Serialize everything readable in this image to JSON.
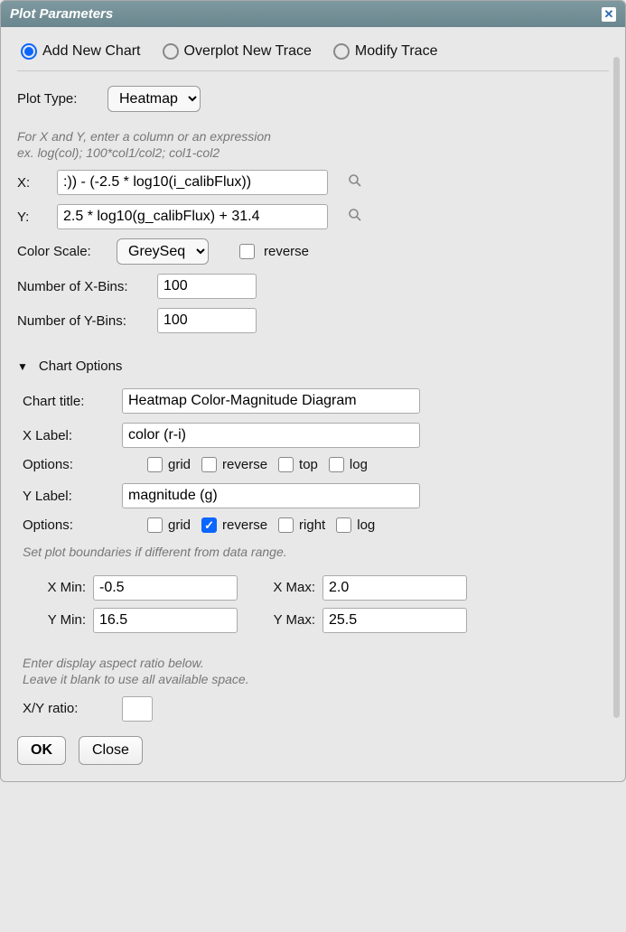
{
  "title": "Plot Parameters",
  "modes": {
    "add": "Add New Chart",
    "overplot": "Overplot New Trace",
    "modify": "Modify Trace",
    "selected": "add"
  },
  "plotType": {
    "label": "Plot Type:",
    "value": "Heatmap"
  },
  "xyHint1": "For X and Y, enter a column or an expression",
  "xyHint2": "ex. log(col); 100*col1/col2; col1-col2",
  "x": {
    "label": "X:",
    "value": ":)) - (-2.5 * log10(i_calibFlux))"
  },
  "y": {
    "label": "Y:",
    "value": "2.5 * log10(g_calibFlux) + 31.4"
  },
  "colorScale": {
    "label": "Color Scale:",
    "value": "GreySeq",
    "reverseLabel": "reverse"
  },
  "xBins": {
    "label": "Number of X-Bins:",
    "value": "100"
  },
  "yBins": {
    "label": "Number of Y-Bins:",
    "value": "100"
  },
  "chartOptionsHeader": "Chart Options",
  "chartTitle": {
    "label": "Chart title:",
    "value": "Heatmap Color-Magnitude Diagram"
  },
  "xLabel": {
    "label": "X Label:",
    "value": "color (r-i)"
  },
  "xOptions": {
    "label": "Options:",
    "grid": "grid",
    "reverse": "reverse",
    "top": "top",
    "log": "log"
  },
  "yLabel": {
    "label": "Y Label:",
    "value": "magnitude (g)"
  },
  "yOptions": {
    "label": "Options:",
    "grid": "grid",
    "reverse": "reverse",
    "right": "right",
    "log": "log"
  },
  "boundsHint": "Set plot boundaries if different from data range.",
  "xmin": {
    "label": "X Min:",
    "value": "-0.5"
  },
  "xmax": {
    "label": "X Max:",
    "value": "2.0"
  },
  "ymin": {
    "label": "Y Min:",
    "value": "16.5"
  },
  "ymax": {
    "label": "Y Max:",
    "value": "25.5"
  },
  "ratioHint1": "Enter display aspect ratio below.",
  "ratioHint2": "Leave it blank to use all available space.",
  "ratio": {
    "label": "X/Y ratio:",
    "value": ""
  },
  "buttons": {
    "ok": "OK",
    "close": "Close"
  }
}
